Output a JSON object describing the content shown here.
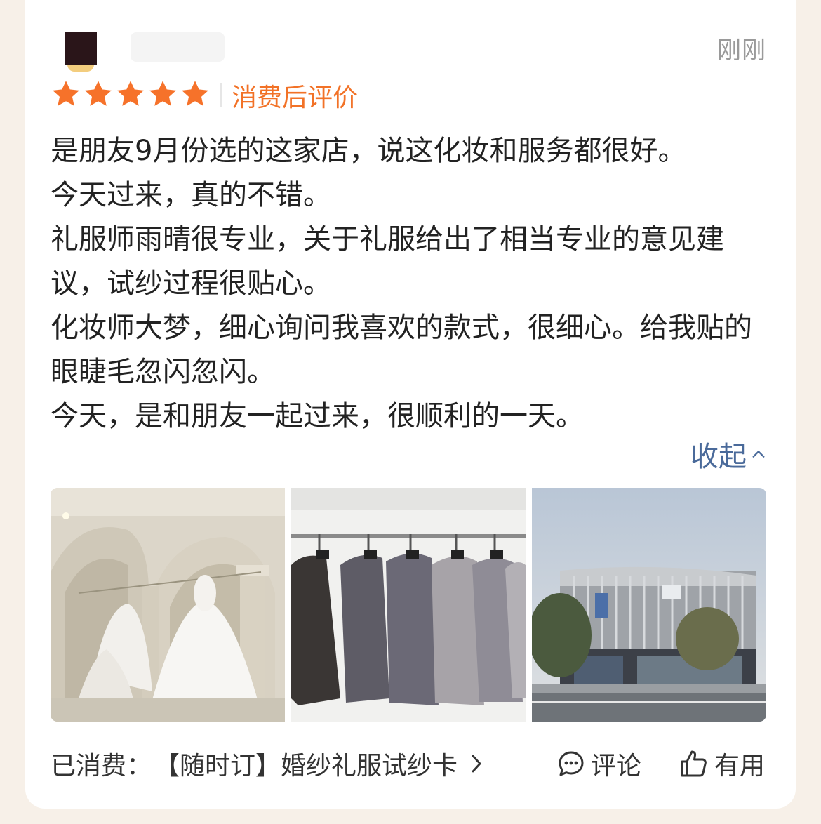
{
  "review": {
    "time": "刚刚",
    "rating": 5,
    "tag": "消费后评价",
    "paragraphs": [
      "是朋友9月份选的这家店，说这化妆和服务都很好。",
      "今天过来，真的不错。",
      "礼服师雨晴很专业，关于礼服给出了相当专业的意见建议，试纱过程很贴心。",
      "化妆师大梦，细心询问我喜欢的款式，很细心。给我贴的眼睫毛忽闪忽闪。",
      "今天，是和朋友一起过来，很顺利的一天。"
    ],
    "collapse_label": "收起",
    "photos": [
      {
        "icon": "wedding-dress-photo"
      },
      {
        "icon": "suits-photo"
      },
      {
        "icon": "storefront-photo"
      }
    ]
  },
  "footer": {
    "consumed_label": "已消费：",
    "product": "【随时订】婚纱礼服试纱卡",
    "comment_label": "评论",
    "useful_label": "有用"
  },
  "colors": {
    "star": "#f6722a",
    "tag": "#f27227",
    "link": "#4a6a9a",
    "text": "#222222",
    "muted": "#9a9a9a"
  }
}
